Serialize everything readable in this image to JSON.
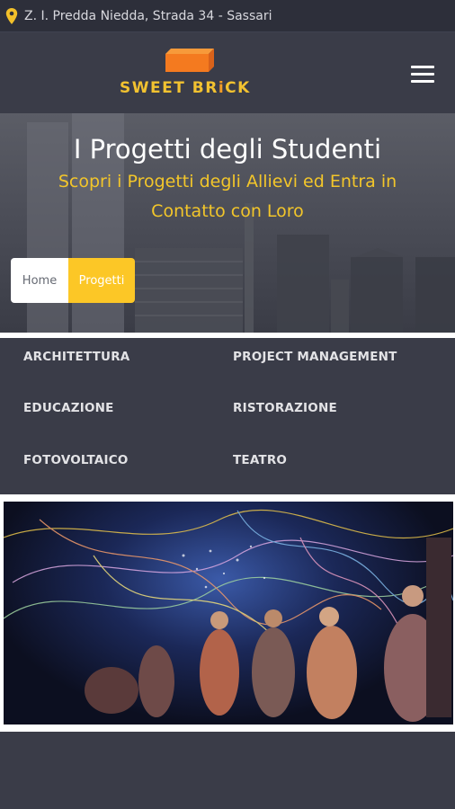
{
  "topbar": {
    "icon": "map-pin-icon",
    "address": "Z. I. Predda Niedda, Strada 34 - Sassari"
  },
  "header": {
    "logo": {
      "word1": "SWEET ",
      "word2a": "BR",
      "word2b": "i",
      "word2c": "CK"
    },
    "menu_icon": "hamburger-menu-icon"
  },
  "hero": {
    "title": "I Progetti degli Studenti",
    "subtitle": "Scopri i Progetti degli Allievi ed Entra in Contatto con Loro",
    "breadcrumb": {
      "home": "Home",
      "current": "Progetti"
    }
  },
  "categories": {
    "items": [
      {
        "label": "ARCHITETTURA"
      },
      {
        "label": "PROJECT MANAGEMENT"
      },
      {
        "label": "EDUCAZIONE"
      },
      {
        "label": "RISTORAZIONE"
      },
      {
        "label": "FOTOVOLTAICO"
      },
      {
        "label": "TEATRO"
      }
    ]
  },
  "colors": {
    "accent_yellow": "#fcc726",
    "logo_orange": "#f39c26",
    "dark_panel": "#3a3c48"
  }
}
